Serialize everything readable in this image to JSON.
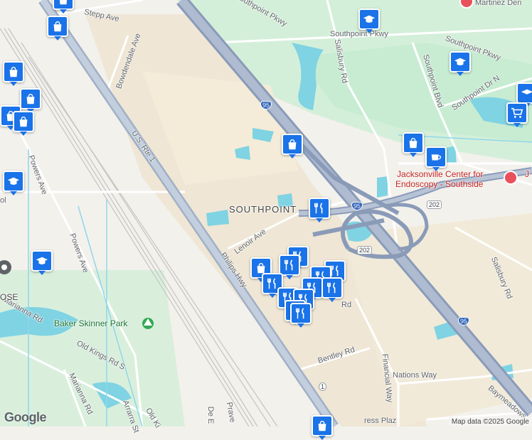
{
  "map": {
    "neighborhood": "SOUTHPOINT",
    "attribution": "Map data ©2025 Google",
    "logo": "Google",
    "roads": {
      "stepp": "Stepp Ave",
      "bowdendale": "Bowdendale Ave",
      "us1": "U.S. Rte 1",
      "powers1": "Powers Ave",
      "powers2": "Powers Ave",
      "southpoint_pkwy_1": "Southpoint Pkwy",
      "southpoint_pkwy_2": "Southpoint Pkwy",
      "southpoint_pkwy_3": "Southpoint Pkwy",
      "salisbury_1": "Salisbury Rd",
      "salisbury_2": "Salisbury Rd",
      "southpoint_blvd": "Southpoint Blvd",
      "southpoint_dr_n": "Southpoint Dr N",
      "lenoir": "Lenoir Ave",
      "philips": "Philips Hwy",
      "rd_partial": "Rd",
      "bentley": "Bentley Rd",
      "financial": "Financial Way",
      "nations": "Nations Way",
      "baymeadows": "Baymeadows",
      "old_kings_1": "Old Kings Rd S",
      "old_kings_2": "Old Ki",
      "marianna_1": "Marianna Rd",
      "marianna_2": "Marianna Rd",
      "arrarra": "Arrarra St",
      "prave": "Prave",
      "de": "De E",
      "cypress": "ress Plaz",
      "martinez": "Martinez Den",
      "ose": "OSE",
      "ol": "ol",
      "jx_partial": "J"
    },
    "shields": {
      "i95_a": "95",
      "i95_b": "95",
      "i95_c": "95",
      "r202_a": "202",
      "r202_b": "202",
      "us1_shield": "1"
    },
    "places": {
      "park": "Baker Skinner Park",
      "hospital_line1": "Jacksonville Center for",
      "hospital_line2": "Endoscopy - Southside"
    },
    "icons": {
      "shopping": "shopping-bag-icon",
      "school": "graduation-cap-icon",
      "restaurant": "fork-knife-icon",
      "cafe": "coffee-cup-icon",
      "grocery": "shopping-cart-icon"
    },
    "colors": {
      "pin": "#1a73e8",
      "highway": "#8a9bb8",
      "water": "#7fd3e3",
      "park": "#c7ecd2",
      "commercial": "#efe6d5"
    }
  }
}
